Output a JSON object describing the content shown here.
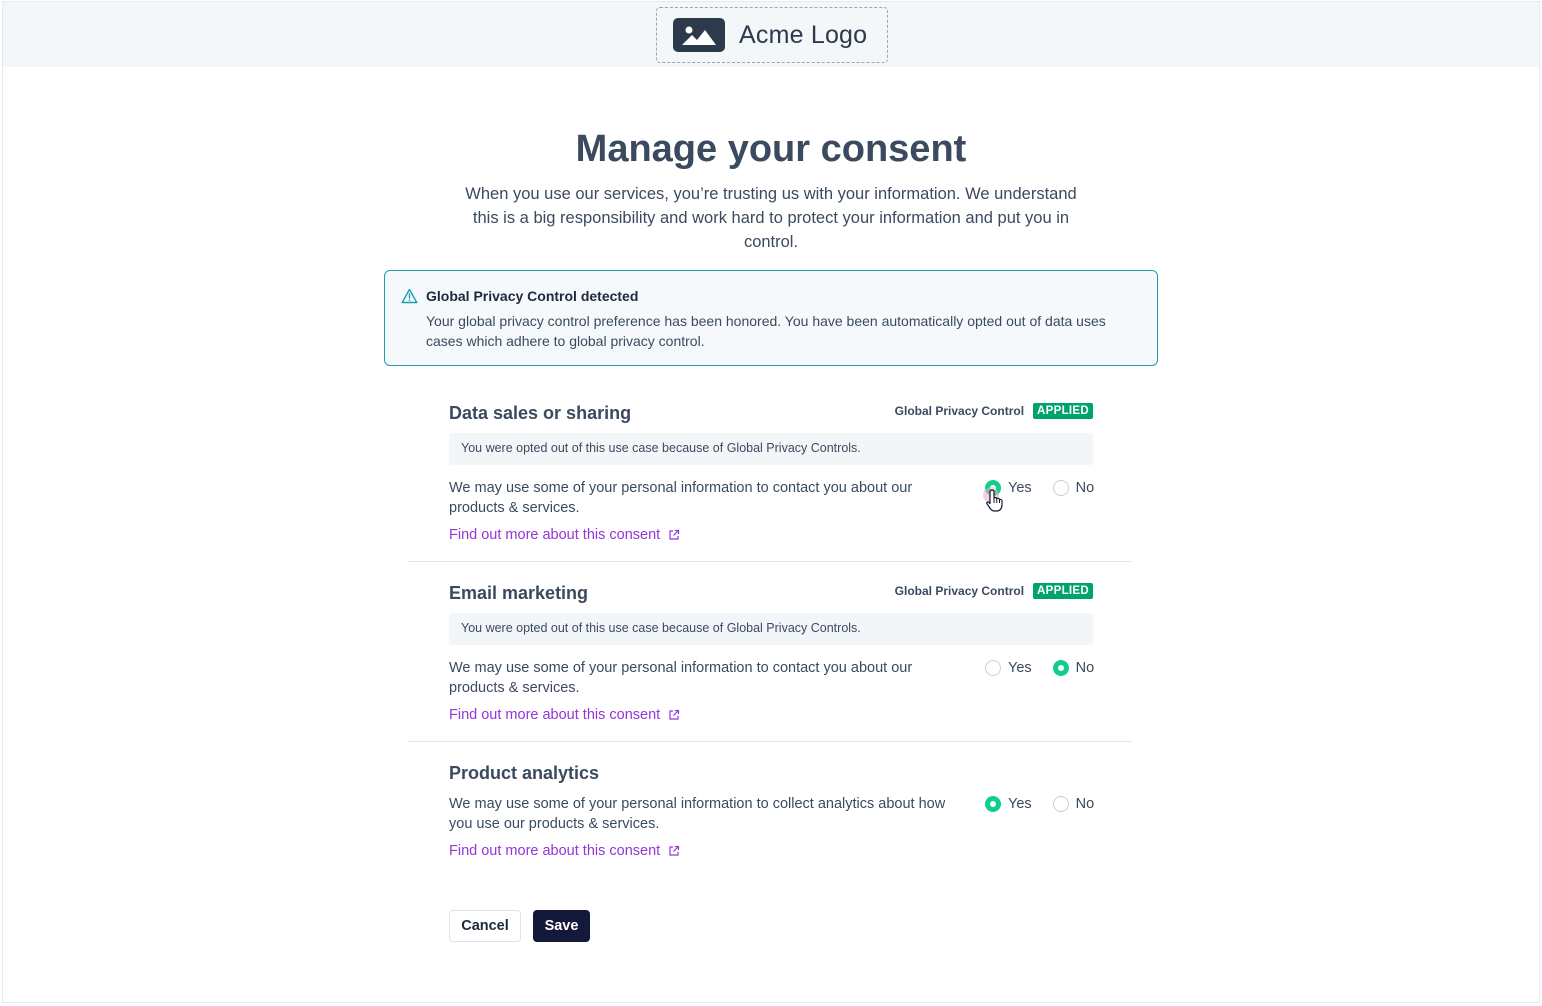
{
  "header": {
    "logo_text": "Acme Logo",
    "logo_icon": "image-icon"
  },
  "page": {
    "title": "Manage your consent",
    "subtitle": "When you use our services, you’re trusting us with your information. We understand this is a big responsibility and work hard to protect your information and put you in control."
  },
  "gpc_alert": {
    "icon": "warning-triangle-icon",
    "title": "Global Privacy Control detected",
    "body": "Your global privacy control preference has been honored. You have been automatically opted out of data uses cases which adhere to global privacy control."
  },
  "consents": [
    {
      "title": "Data sales or sharing",
      "gpc_label": "Global Privacy Control",
      "gpc_badge": "APPLIED",
      "note": "You were opted out of this use case because of Global Privacy Controls.",
      "description": "We may use some of your personal information to contact you about our products & services.",
      "yes_label": "Yes",
      "no_label": "No",
      "selected": "yes",
      "link": "Find out more about this consent"
    },
    {
      "title": "Email marketing",
      "gpc_label": "Global Privacy Control",
      "gpc_badge": "APPLIED",
      "note": "You were opted out of this use case because of Global Privacy Controls.",
      "description": "We may use some of your personal information to contact you about our products & services.",
      "yes_label": "Yes",
      "no_label": "No",
      "selected": "no",
      "link": "Find out more about this consent"
    },
    {
      "title": "Product analytics",
      "description": "We may use some of your personal information to collect analytics about how you use our products & services.",
      "yes_label": "Yes",
      "no_label": "No",
      "selected": "yes",
      "link": "Find out more about this consent"
    }
  ],
  "actions": {
    "cancel_label": "Cancel",
    "save_label": "Save"
  },
  "colors": {
    "accent_green": "#10cf8a",
    "badge_green": "#00a36c",
    "link_purple": "#9336d7",
    "alert_border": "#1f9db3",
    "primary_button": "#13193a"
  }
}
